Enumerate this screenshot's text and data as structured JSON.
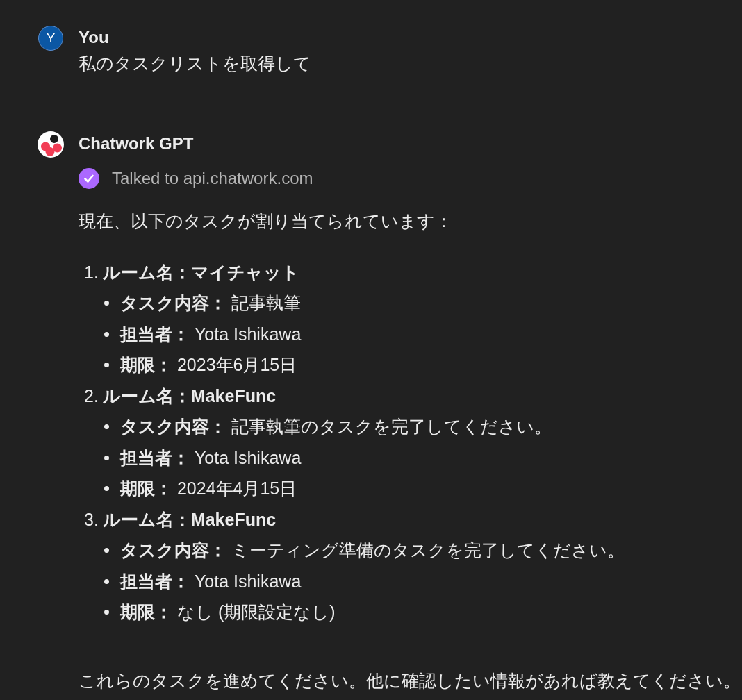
{
  "messages": [
    {
      "kind": "user",
      "author": "You",
      "avatar_letter": "Y",
      "text": "私のタスクリストを取得して"
    },
    {
      "kind": "assistant",
      "author": "Chatwork GPT",
      "tool_call": {
        "completed": true,
        "text": "Talked to api.chatwork.com"
      },
      "intro": "現在、以下のタスクが割り当てられています：",
      "tasks": [
        {
          "number": "1.",
          "room": "ルーム名：マイチャット",
          "details": [
            "**タスク内容：** 記事執筆",
            "**担当者：** Yota Ishikawa",
            "**期限：** 2023年6月15日"
          ]
        },
        {
          "number": "2.",
          "room": "ルーム名：MakeFunc",
          "details": [
            "**タスク内容：** 記事執筆のタスクを完了してください。",
            "**担当者：** Yota Ishikawa",
            "**期限：** 2024年4月15日"
          ]
        },
        {
          "number": "3.",
          "room": "ルーム名：MakeFunc",
          "details": [
            "**タスク内容：** ミーティング準備のタスクを完了してください。",
            "**担当者：** Yota Ishikawa",
            "**期限：** なし (期限設定なし)"
          ]
        }
      ],
      "closing": "これらのタスクを進めてください。他に確認したい情報があれば教えてください。"
    }
  ]
}
